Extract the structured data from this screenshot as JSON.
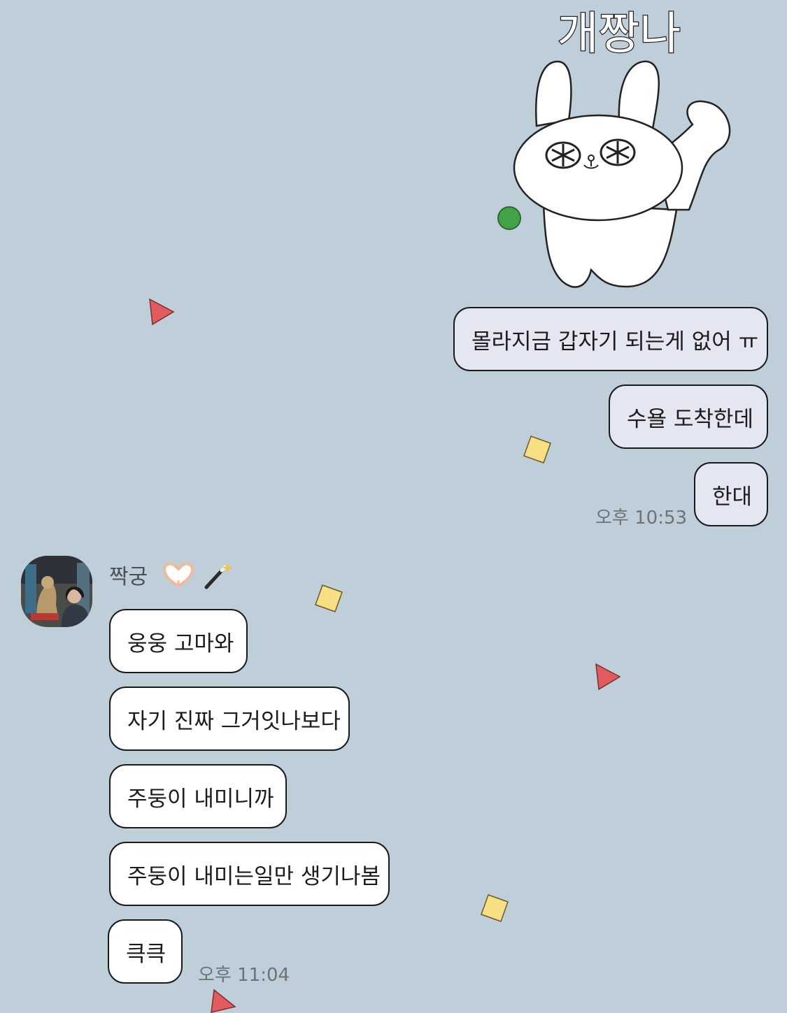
{
  "sticker": {
    "text": "개짱나",
    "icon": "rabbit-sticker"
  },
  "outgoing_messages": [
    {
      "text": "몰라지금 갑자기 되는게 없어 ㅠ"
    },
    {
      "text": "수욜 도착한데"
    },
    {
      "text": "한대"
    }
  ],
  "outgoing_time": "오후 10:53",
  "sender": {
    "name": "짝궁",
    "emoji": "🫶🏻🪄"
  },
  "incoming_messages": [
    {
      "text": "웅웅 고마와"
    },
    {
      "text": "자기 진짜 그거잇나보다"
    },
    {
      "text": "주둥이 내미니까"
    },
    {
      "text": "주둥이 내미는일만 생기나봄"
    },
    {
      "text": "큭큭"
    }
  ],
  "incoming_time": "오후 11:04",
  "colors": {
    "background": "#bfcfd9",
    "outgoing_bubble": "#e4e6f2",
    "incoming_bubble": "#ffffff",
    "confetti_red": "#e25c5f",
    "confetti_yellow": "#f9df83",
    "confetti_green": "#44a24a"
  }
}
